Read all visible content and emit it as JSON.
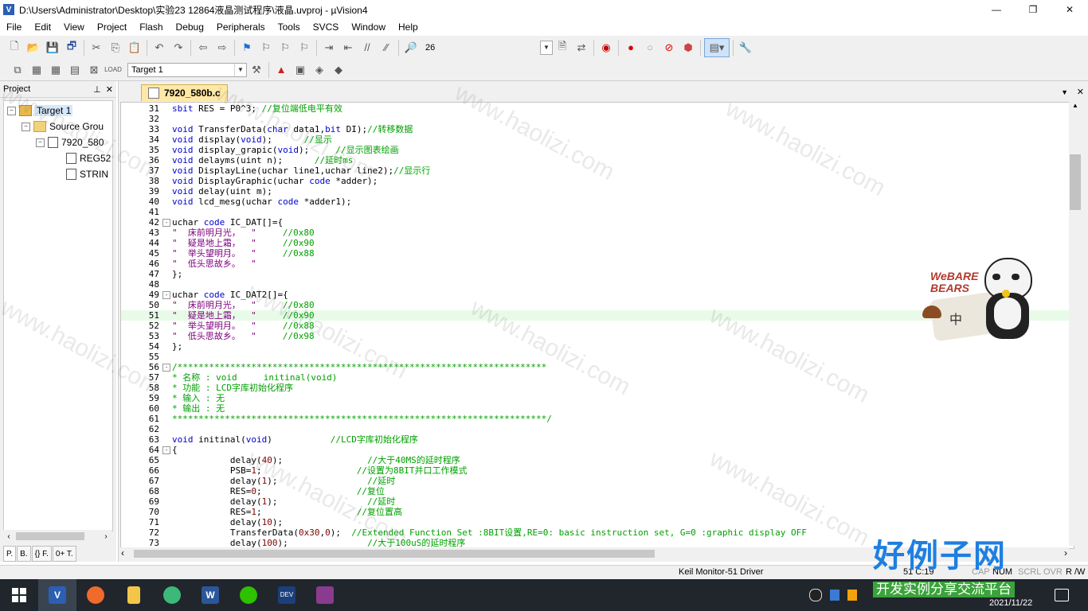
{
  "window": {
    "title": "D:\\Users\\Administrator\\Desktop\\实验23 12864液晶测试程序\\液晶.uvproj - µVision4"
  },
  "menu": [
    "File",
    "Edit",
    "View",
    "Project",
    "Flash",
    "Debug",
    "Peripherals",
    "Tools",
    "SVCS",
    "Window",
    "Help"
  ],
  "toolbar": {
    "find_value": "26",
    "target_value": "Target 1"
  },
  "project_panel": {
    "title": "Project",
    "tree": [
      {
        "label": "Target 1",
        "level": 0
      },
      {
        "label": "Source Grou",
        "level": 1
      },
      {
        "label": "7920_580",
        "level": 2
      },
      {
        "label": "REG52",
        "level": 3
      },
      {
        "label": "STRIN",
        "level": 3
      }
    ],
    "tabs": [
      "P.",
      "B.",
      "{} F.",
      "0+ T."
    ]
  },
  "editor": {
    "tab_label": "7920_580b.c",
    "lines": [
      {
        "n": "31",
        "parts": [
          [
            "kw",
            "sbit"
          ],
          [
            "tx",
            " RES = P0^3; "
          ],
          [
            "cm",
            "//复位端低电平有效"
          ]
        ]
      },
      {
        "n": "32",
        "parts": []
      },
      {
        "n": "33",
        "parts": [
          [
            "kw",
            "void"
          ],
          [
            "tx",
            " TransferData("
          ],
          [
            "kw",
            "char"
          ],
          [
            "tx",
            " data1,"
          ],
          [
            "kw",
            "bit"
          ],
          [
            "tx",
            " DI);"
          ],
          [
            "cm",
            "//转移数据"
          ]
        ]
      },
      {
        "n": "34",
        "parts": [
          [
            "kw",
            "void"
          ],
          [
            "tx",
            " display("
          ],
          [
            "kw",
            "void"
          ],
          [
            "tx",
            ");      "
          ],
          [
            "cm",
            "//显示"
          ]
        ]
      },
      {
        "n": "35",
        "parts": [
          [
            "kw",
            "void"
          ],
          [
            "tx",
            " display_grapic("
          ],
          [
            "kw",
            "void"
          ],
          [
            "tx",
            ");     "
          ],
          [
            "cm",
            "//显示图表绘画"
          ]
        ]
      },
      {
        "n": "36",
        "parts": [
          [
            "kw",
            "void"
          ],
          [
            "tx",
            " delayms(uint n);      "
          ],
          [
            "cm",
            "//延时ms"
          ]
        ]
      },
      {
        "n": "37",
        "parts": [
          [
            "kw",
            "void"
          ],
          [
            "tx",
            " DisplayLine(uchar line1,uchar line2);"
          ],
          [
            "cm",
            "//显示行"
          ]
        ]
      },
      {
        "n": "38",
        "parts": [
          [
            "kw",
            "void"
          ],
          [
            "tx",
            " DisplayGraphic(uchar "
          ],
          [
            "kw",
            "code"
          ],
          [
            "tx",
            " *adder);"
          ]
        ]
      },
      {
        "n": "39",
        "parts": [
          [
            "kw",
            "void"
          ],
          [
            "tx",
            " delay(uint m);"
          ]
        ]
      },
      {
        "n": "40",
        "parts": [
          [
            "kw",
            "void"
          ],
          [
            "tx",
            " lcd_mesg(uchar "
          ],
          [
            "kw",
            "code"
          ],
          [
            "tx",
            " *adder1);"
          ]
        ]
      },
      {
        "n": "41",
        "parts": []
      },
      {
        "n": "42",
        "fold": "-",
        "parts": [
          [
            "tx",
            "uchar "
          ],
          [
            "kw",
            "code"
          ],
          [
            "tx",
            " IC_DAT[]={"
          ]
        ]
      },
      {
        "n": "43",
        "parts": [
          [
            "st",
            "\"  床前明月光，  \""
          ],
          [
            "tx",
            "     "
          ],
          [
            "cm",
            "//0x80"
          ]
        ]
      },
      {
        "n": "44",
        "parts": [
          [
            "st",
            "\"  疑是地上霜，  \""
          ],
          [
            "tx",
            "     "
          ],
          [
            "cm",
            "//0x90"
          ]
        ]
      },
      {
        "n": "45",
        "parts": [
          [
            "st",
            "\"  举头望明月。  \""
          ],
          [
            "tx",
            "     "
          ],
          [
            "cm",
            "//0x88"
          ]
        ]
      },
      {
        "n": "46",
        "parts": [
          [
            "st",
            "\"  低头思故乡。  \""
          ]
        ]
      },
      {
        "n": "47",
        "parts": [
          [
            "tx",
            "};"
          ]
        ]
      },
      {
        "n": "48",
        "parts": []
      },
      {
        "n": "49",
        "fold": "-",
        "parts": [
          [
            "tx",
            "uchar "
          ],
          [
            "kw",
            "code"
          ],
          [
            "tx",
            " IC_DAT2[]={"
          ]
        ]
      },
      {
        "n": "50",
        "parts": [
          [
            "st",
            "\"  床前明月光，  \""
          ],
          [
            "tx",
            "     "
          ],
          [
            "cm",
            "//0x80"
          ]
        ]
      },
      {
        "n": "51",
        "hl": true,
        "parts": [
          [
            "st",
            "\"  疑是地上霜，  \""
          ],
          [
            "tx",
            "     "
          ],
          [
            "cm",
            "//0x90"
          ]
        ]
      },
      {
        "n": "52",
        "parts": [
          [
            "st",
            "\"  举头望明月。  \""
          ],
          [
            "tx",
            "     "
          ],
          [
            "cm",
            "//0x88"
          ]
        ]
      },
      {
        "n": "53",
        "parts": [
          [
            "st",
            "\"  低头思故乡。  \""
          ],
          [
            "tx",
            "     "
          ],
          [
            "cm",
            "//0x98"
          ]
        ]
      },
      {
        "n": "54",
        "parts": [
          [
            "tx",
            "};"
          ]
        ]
      },
      {
        "n": "55",
        "parts": []
      },
      {
        "n": "56",
        "fold": "-",
        "parts": [
          [
            "cm",
            "/**********************************************************************"
          ]
        ]
      },
      {
        "n": "57",
        "parts": [
          [
            "cm",
            "* 名称 : void     initinal(void)"
          ]
        ]
      },
      {
        "n": "58",
        "parts": [
          [
            "cm",
            "* 功能 : LCD字库初始化程序"
          ]
        ]
      },
      {
        "n": "59",
        "parts": [
          [
            "cm",
            "* 输入 : 无"
          ]
        ]
      },
      {
        "n": "60",
        "parts": [
          [
            "cm",
            "* 输出 : 无"
          ]
        ]
      },
      {
        "n": "61",
        "parts": [
          [
            "cm",
            "***********************************************************************/"
          ]
        ]
      },
      {
        "n": "62",
        "parts": []
      },
      {
        "n": "63",
        "parts": [
          [
            "kw",
            "void"
          ],
          [
            "tx",
            " initinal("
          ],
          [
            "kw",
            "void"
          ],
          [
            "tx",
            ")           "
          ],
          [
            "cm",
            "//LCD字库初始化程序"
          ]
        ]
      },
      {
        "n": "64",
        "fold": "-",
        "parts": [
          [
            "tx",
            "{"
          ]
        ]
      },
      {
        "n": "65",
        "parts": [
          [
            "tx",
            "           delay("
          ],
          [
            "nm",
            "40"
          ],
          [
            "tx",
            ");                "
          ],
          [
            "cm",
            "//大于40MS的延时程序"
          ]
        ]
      },
      {
        "n": "66",
        "parts": [
          [
            "tx",
            "           PSB="
          ],
          [
            "nm",
            "1"
          ],
          [
            "tx",
            ";                  "
          ],
          [
            "cm",
            "//设置为8BIT并口工作模式"
          ]
        ]
      },
      {
        "n": "67",
        "parts": [
          [
            "tx",
            "           delay("
          ],
          [
            "nm",
            "1"
          ],
          [
            "tx",
            ");                 "
          ],
          [
            "cm",
            "//延时"
          ]
        ]
      },
      {
        "n": "68",
        "parts": [
          [
            "tx",
            "           RES="
          ],
          [
            "nm",
            "0"
          ],
          [
            "tx",
            ";                  "
          ],
          [
            "cm",
            "//复位"
          ]
        ]
      },
      {
        "n": "69",
        "parts": [
          [
            "tx",
            "           delay("
          ],
          [
            "nm",
            "1"
          ],
          [
            "tx",
            ");                 "
          ],
          [
            "cm",
            "//延时"
          ]
        ]
      },
      {
        "n": "70",
        "parts": [
          [
            "tx",
            "           RES="
          ],
          [
            "nm",
            "1"
          ],
          [
            "tx",
            ";                  "
          ],
          [
            "cm",
            "//复位置高"
          ]
        ]
      },
      {
        "n": "71",
        "parts": [
          [
            "tx",
            "           delay("
          ],
          [
            "nm",
            "10"
          ],
          [
            "tx",
            ");"
          ]
        ]
      },
      {
        "n": "72",
        "parts": [
          [
            "tx",
            "           TransferData("
          ],
          [
            "nm",
            "0x30"
          ],
          [
            "tx",
            ","
          ],
          [
            "nm",
            "0"
          ],
          [
            "tx",
            ");  "
          ],
          [
            "cm",
            "//Extended Function Set :8BIT设置,RE=0: basic instruction set, G=0 :graphic display OFF"
          ]
        ]
      },
      {
        "n": "73",
        "parts": [
          [
            "tx",
            "           delay("
          ],
          [
            "nm",
            "100"
          ],
          [
            "tx",
            ");               "
          ],
          [
            "cm",
            "//大于100uS的延时程序"
          ]
        ]
      }
    ]
  },
  "status": {
    "driver": "Keil Monitor-51 Driver",
    "position": "51 C:19",
    "caps": "CAP",
    "num": "NUM",
    "scrl": "SCRL",
    "ovr": "OVR",
    "rw": "R /W"
  },
  "overlay": {
    "logo_big": "好例子网",
    "logo_small": "开发实例分享交流平台",
    "date": "2021/11/22",
    "watermark": "www.haolizi.com",
    "sticker_text": "WeBARE BEARS",
    "sticker_cn": "中"
  },
  "taskbar": {
    "items": [
      "windows-start",
      "keil-app",
      "firefox",
      "folder",
      "wechat-contact",
      "word",
      "wechat",
      "devcpp",
      "winrar"
    ]
  }
}
